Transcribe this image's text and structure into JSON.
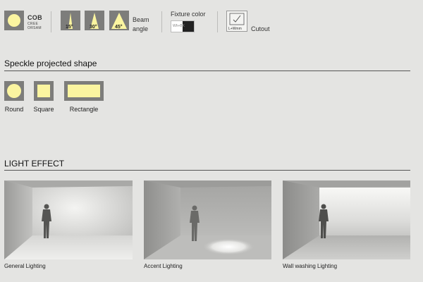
{
  "specs": {
    "cob": {
      "title": "COB",
      "sub1": "CREE",
      "sub2": "ORSAM"
    },
    "beam": {
      "angles": [
        "15°",
        "30°",
        "45°"
      ],
      "label_line1": "Beam",
      "label_line2": "angle"
    },
    "fixture": {
      "label": "Fixture color",
      "swatch_text": "Wh+BK"
    },
    "cutout": {
      "icon_text": "L+Wmm",
      "label": "Cutout"
    }
  },
  "speckle": {
    "title": "Speckle projected shape",
    "shapes": [
      {
        "name": "Round"
      },
      {
        "name": "Square"
      },
      {
        "name": "Rectangle"
      }
    ]
  },
  "light_effect": {
    "title": "LIGHT EFFECT",
    "photos": [
      {
        "caption": "General Lighting"
      },
      {
        "caption": "Accent Lighting"
      },
      {
        "caption": "Wall washing Lighting"
      }
    ]
  },
  "colors": {
    "background": "#e4e4e2",
    "icon_box": "#7d7d7b",
    "light_yellow": "#fbf5a0"
  }
}
